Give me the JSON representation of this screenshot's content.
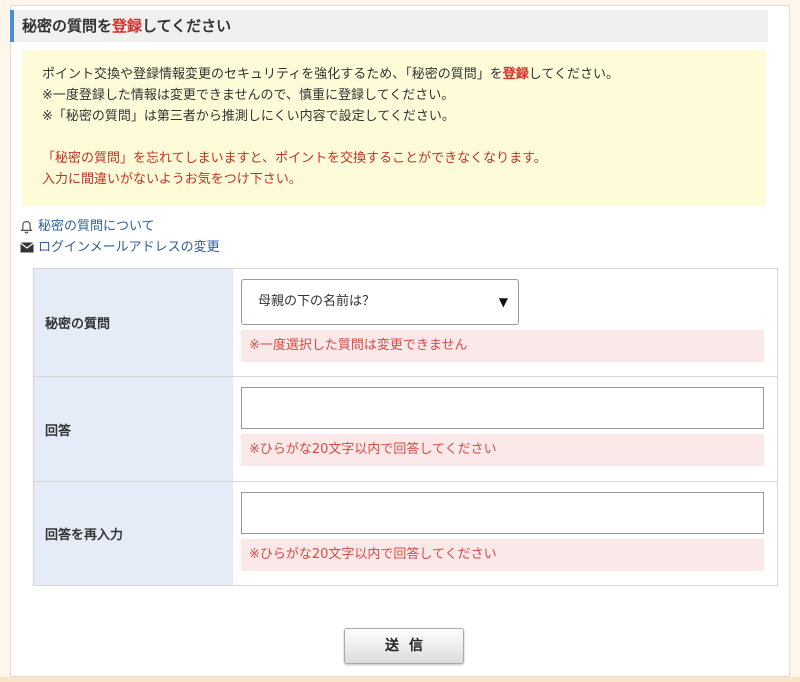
{
  "heading": {
    "prefix": "秘密の質問を",
    "accent": "登録",
    "suffix": "してください"
  },
  "notice": {
    "line1_prefix": "ポイント交換や登録情報変更のセキュリティを強化するため、「秘密の質問」を",
    "line1_accent": "登録",
    "line1_suffix": "してください。",
    "line2": "※一度登録した情報は変更できませんので、慎重に登録してください。",
    "line3": "※「秘密の質問」は第三者から推測しにくい内容で設定してください。",
    "warning1": "「秘密の質問」を忘れてしまいますと、ポイントを交換することができなくなります。",
    "warning2": "入力に間違いがないようお気をつけ下さい。"
  },
  "links": {
    "about": "秘密の質問について",
    "change_email": "ログインメールアドレスの変更"
  },
  "form": {
    "question_label": "秘密の質問",
    "question_selected": "母親の下の名前は？",
    "question_hint": "※一度選択した質問は変更できません",
    "answer_label": "回答",
    "answer_value": "",
    "answer_hint": "※ひらがな20文字以内で回答してください",
    "answer_confirm_label": "回答を再入力",
    "answer_confirm_value": "",
    "answer_confirm_hint": "※ひらがな20文字以内で回答してください"
  },
  "submit_label": "送信",
  "icons": {
    "bell": "bell-icon",
    "mail": "mail-icon",
    "dropdown": "triangle-down-icon"
  },
  "colors": {
    "accent_red": "#d9302a",
    "link_blue": "#2f5f9c",
    "heading_bar": "#4a8fd0",
    "notice_bg": "#fdfbd8",
    "label_bg": "#e5ebf7",
    "hint_bg": "#fbe9e9"
  }
}
